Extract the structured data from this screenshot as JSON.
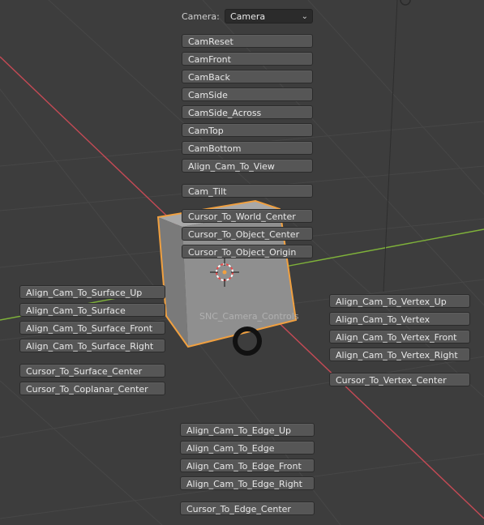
{
  "camera": {
    "label": "Camera:",
    "selected": "Camera"
  },
  "top_buttons": [
    "CamReset",
    "CamFront",
    "CamBack",
    "CamSide",
    "CamSide_Across",
    "CamTop",
    "CamBottom",
    "Align_Cam_To_View"
  ],
  "tilt_button": "Cam_Tilt",
  "cursor_buttons": [
    "Cursor_To_World_Center",
    "Cursor_To_Object_Center",
    "Cursor_To_Object_Origin"
  ],
  "surface_buttons": [
    "Align_Cam_To_Surface_Up",
    "Align_Cam_To_Surface",
    "Align_Cam_To_Surface_Front",
    "Align_Cam_To_Surface_Right"
  ],
  "surface_cursor_buttons": [
    "Cursor_To_Surface_Center",
    "Cursor_To_Coplanar_Center"
  ],
  "vertex_buttons": [
    "Align_Cam_To_Vertex_Up",
    "Align_Cam_To_Vertex",
    "Align_Cam_To_Vertex_Front",
    "Align_Cam_To_Vertex_Right"
  ],
  "vertex_cursor_button": "Cursor_To_Vertex_Center",
  "edge_buttons": [
    "Align_Cam_To_Edge_Up",
    "Align_Cam_To_Edge",
    "Align_Cam_To_Edge_Front",
    "Align_Cam_To_Edge_Right"
  ],
  "edge_cursor_button": "Cursor_To_Edge_Center",
  "overlay_label": "SNC_Camera_Controls",
  "colors": {
    "background": "#3d3d3d",
    "button": "#565656",
    "selection": "#f0a040",
    "x_axis": "#c44a55",
    "y_axis": "#7fb23a"
  }
}
